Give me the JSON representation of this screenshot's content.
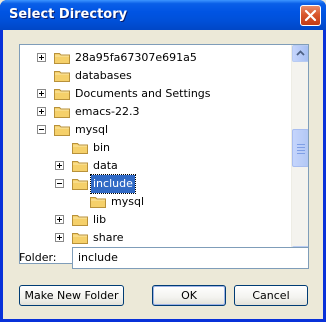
{
  "window": {
    "title": "Select Directory",
    "close_glyph": "✕"
  },
  "tree": {
    "items": [
      {
        "label": "28a95fa67307e691a5",
        "expander": "plus",
        "selected": false
      },
      {
        "label": "databases",
        "expander": "none",
        "selected": false
      },
      {
        "label": "Documents and Settings",
        "expander": "plus",
        "selected": false
      },
      {
        "label": "emacs-22.3",
        "expander": "plus",
        "selected": false
      },
      {
        "label": "mysql",
        "expander": "minus",
        "selected": false
      },
      {
        "label": "bin",
        "expander": "none",
        "selected": false
      },
      {
        "label": "data",
        "expander": "plus",
        "selected": false
      },
      {
        "label": "include",
        "expander": "minus",
        "selected": true
      },
      {
        "label": "mysql",
        "expander": "none",
        "selected": false
      },
      {
        "label": "lib",
        "expander": "plus",
        "selected": false
      },
      {
        "label": "share",
        "expander": "plus",
        "selected": false
      }
    ],
    "scroll_up_icon": "▲",
    "scroll_down_icon": "▼"
  },
  "folder": {
    "label": "Folder:",
    "value": "include"
  },
  "buttons": {
    "make_new_folder": "Make New Folder",
    "ok": "OK",
    "cancel": "Cancel"
  },
  "colors": {
    "title_bar": "#0054e3",
    "selection": "#316ac5",
    "folder_yellow": "#f5d06a",
    "dialog_bg": "#ece9d8"
  }
}
